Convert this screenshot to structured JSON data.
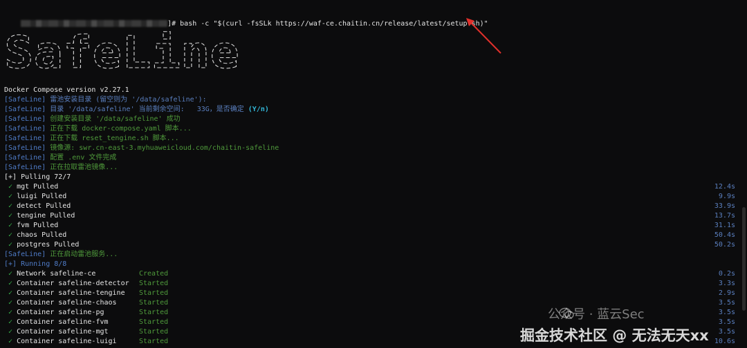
{
  "command": {
    "prompt_suffix": "]# ",
    "text": "bash -c \"$(curl -fsSLk https://waf-ce.chaitin.cn/release/latest/setup.sh)\""
  },
  "logo_text": "SafeLine",
  "colors": {
    "background": "#0c0c0d",
    "prefix_blue": "#4f7cc8",
    "green": "#4f9a3b",
    "cyan": "#33b7d8",
    "check": "#36b24a",
    "arrow_red": "#e0302b"
  },
  "docker_version": "Docker Compose version v2.27.1",
  "prefix": "[SafeLine]",
  "log": [
    {
      "text": " 雷池安装目录 (留空则为 '/data/safeline'):",
      "cls": "blue"
    },
    {
      "text": " 目录 '/data/safeline' 当前剩余空间:   33G，是否确定",
      "cls": "blue",
      "extra": " (Y/n)"
    },
    {
      "text": " 创建安装目录 '/data/safeline' 成功",
      "cls": "green"
    },
    {
      "text": " 正在下载 docker-compose.yaml 脚本...",
      "cls": "green"
    },
    {
      "text": " 正在下载 reset_tengine.sh 脚本...",
      "cls": "green"
    },
    {
      "text": " 镜像源: swr.cn-east-3.myhuaweicloud.com/chaitin-safeline",
      "cls": "green"
    },
    {
      "text": " 配置 .env 文件完成",
      "cls": "green"
    },
    {
      "text": " 正在拉取雷池镜像...",
      "cls": "green"
    }
  ],
  "pulling_header": "[+] Pulling 72/7",
  "pulled": [
    {
      "name": "mgt Pulled",
      "time": "12.4s"
    },
    {
      "name": "luigi Pulled",
      "time": "9.9s"
    },
    {
      "name": "detect Pulled",
      "time": "33.9s"
    },
    {
      "name": "tengine Pulled",
      "time": "13.7s"
    },
    {
      "name": "fvm Pulled",
      "time": "31.1s"
    },
    {
      "name": "chaos Pulled",
      "time": "50.4s"
    },
    {
      "name": "postgres Pulled",
      "time": "50.2s"
    }
  ],
  "starting_msg": " 正在启动雷池服务...",
  "running_header": "[+] Running 8/8",
  "containers": [
    {
      "name": "Network safeline-ce",
      "status": "Created",
      "time": "0.2s"
    },
    {
      "name": "Container safeline-detector",
      "status": "Started",
      "time": "3.3s"
    },
    {
      "name": "Container safeline-tengine",
      "status": "Started",
      "time": "2.9s"
    },
    {
      "name": "Container safeline-chaos",
      "status": "Started",
      "time": "3.5s"
    },
    {
      "name": "Container safeline-pg",
      "status": "Started",
      "time": "3.5s"
    },
    {
      "name": "Container safeline-fvm",
      "status": "Started",
      "time": "3.5s"
    },
    {
      "name": "Container safeline-mgt",
      "status": "Started",
      "time": "3.5s"
    },
    {
      "name": "Container safeline-luigi",
      "status": "Started",
      "time": "10.6s"
    }
  ],
  "check_glyph": "✓",
  "watermark": {
    "line1": "公众号 · 蓝云Sec",
    "line2": "掘金技术社区 @ 无法无天xx"
  }
}
